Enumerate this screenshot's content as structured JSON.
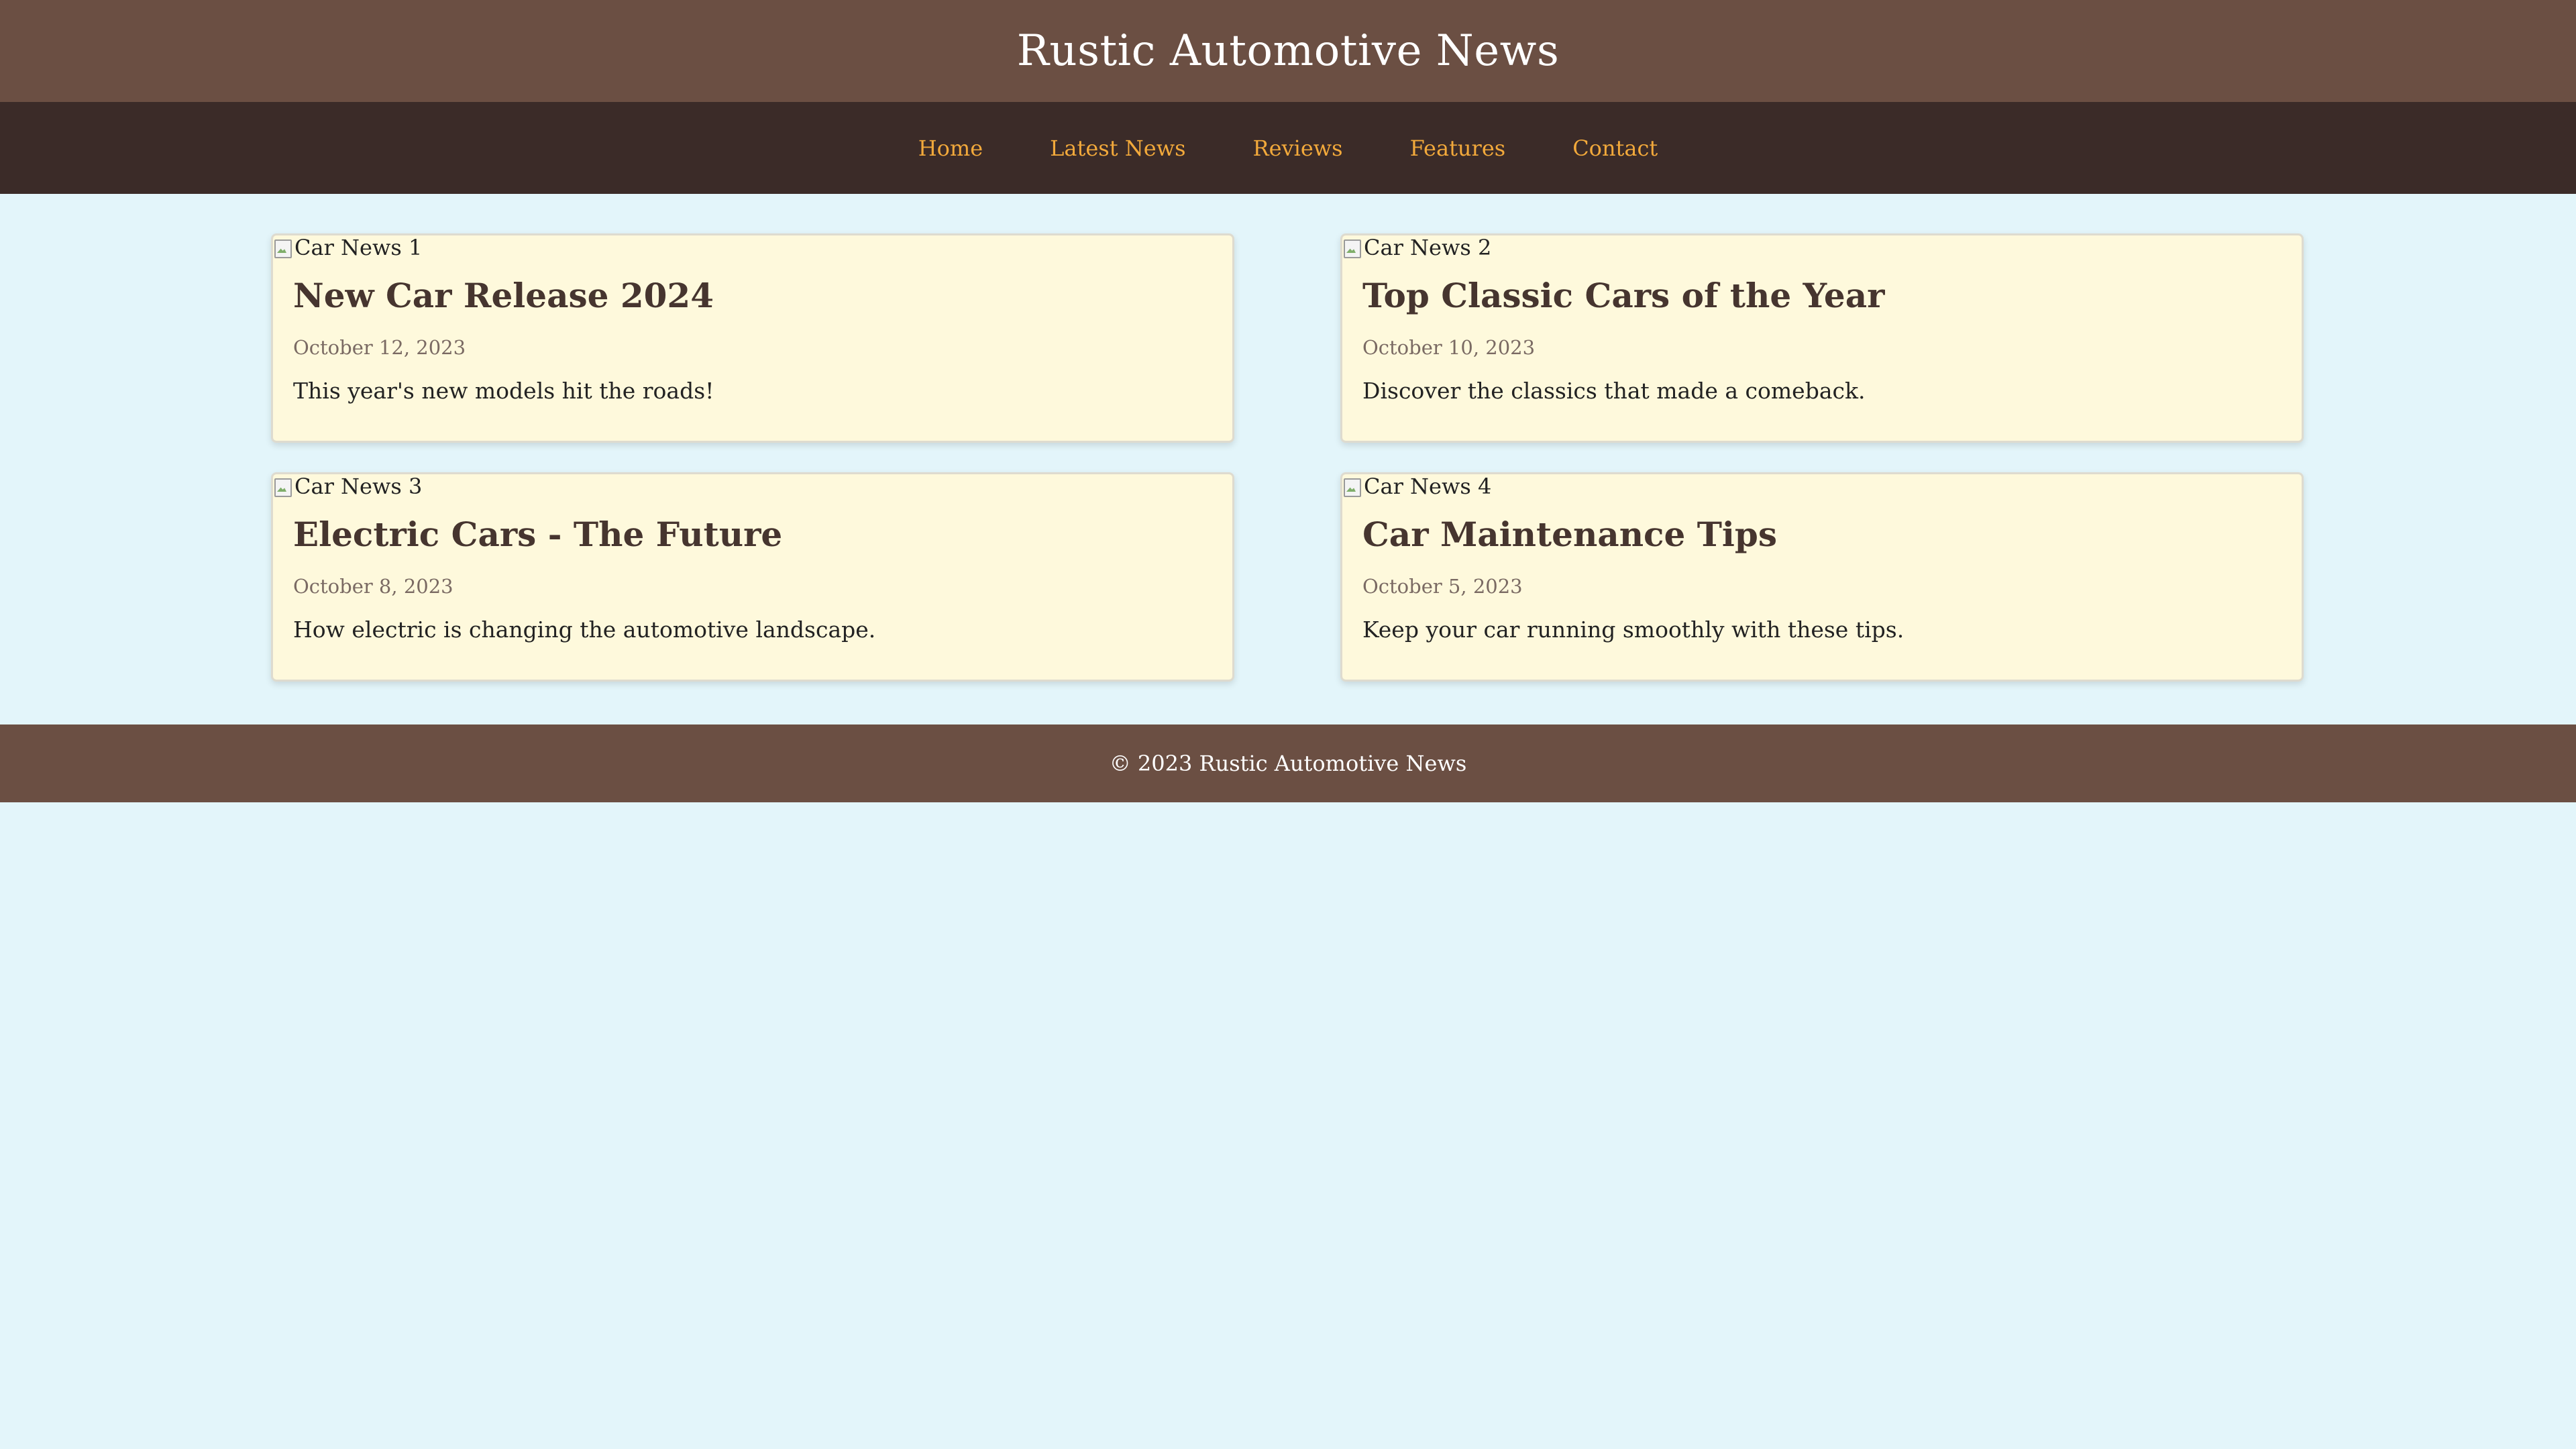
{
  "header": {
    "title": "Rustic Automotive News"
  },
  "nav": {
    "items": [
      {
        "label": "Home"
      },
      {
        "label": "Latest News"
      },
      {
        "label": "Reviews"
      },
      {
        "label": "Features"
      },
      {
        "label": "Contact"
      }
    ]
  },
  "articles": [
    {
      "image_alt": "Car News 1",
      "title": "New Car Release 2024",
      "date": "October 12, 2023",
      "summary": "This year's new models hit the roads!"
    },
    {
      "image_alt": "Car News 2",
      "title": "Top Classic Cars of the Year",
      "date": "October 10, 2023",
      "summary": "Discover the classics that made a comeback."
    },
    {
      "image_alt": "Car News 3",
      "title": "Electric Cars - The Future",
      "date": "October 8, 2023",
      "summary": "How electric is changing the automotive landscape."
    },
    {
      "image_alt": "Car News 4",
      "title": "Car Maintenance Tips",
      "date": "October 5, 2023",
      "summary": "Keep your car running smoothly with these tips."
    }
  ],
  "footer": {
    "text": "© 2023 Rustic Automotive News"
  },
  "colors": {
    "header_bg": "#6b4f43",
    "nav_bg": "#3b2b28",
    "nav_link": "#f2a93b",
    "page_bg": "#e3f5fa",
    "card_bg": "#fef9dc",
    "title_text": "#46352f"
  }
}
